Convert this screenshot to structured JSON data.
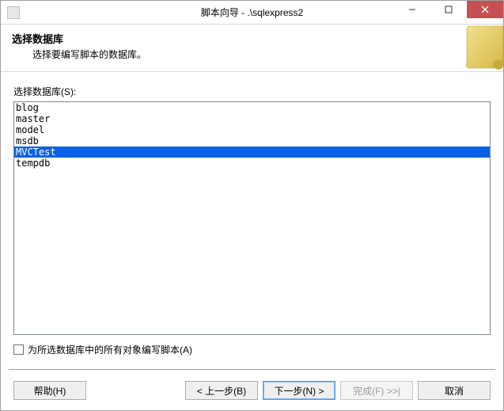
{
  "titlebar": {
    "title": "脚本向导 - .\\sqlexpress2"
  },
  "header": {
    "title": "选择数据库",
    "subtitle": "选择要编写脚本的数据库。"
  },
  "content": {
    "list_label": "选择数据库(S):",
    "items": [
      {
        "label": "blog",
        "selected": false
      },
      {
        "label": "master",
        "selected": false
      },
      {
        "label": "model",
        "selected": false
      },
      {
        "label": "msdb",
        "selected": false
      },
      {
        "label": "MVCTest",
        "selected": true
      },
      {
        "label": "tempdb",
        "selected": false
      }
    ],
    "checkbox_label": "为所选数据库中的所有对象编写脚本(A)",
    "checkbox_checked": false
  },
  "buttons": {
    "help": "帮助(H)",
    "back": "< 上一步(B)",
    "next": "下一步(N) >",
    "finish": "完成(F) >>|",
    "cancel": "取消"
  }
}
